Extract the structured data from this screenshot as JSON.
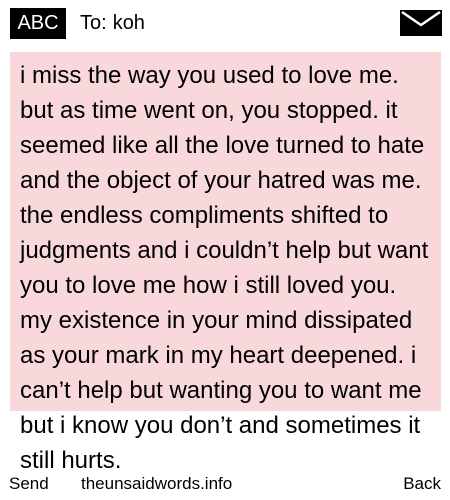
{
  "header": {
    "input_mode": "ABC",
    "to_label": "To:",
    "recipient": "koh",
    "icon": "envelope-icon"
  },
  "message": {
    "body": "i miss the way you used to love me. but as time went on, you stopped. it seemed like all the love turned to hate and the object of your hatred was me. the endless compliments shifted to judgments and i couldn’t help but want you to love me how i still loved you. my existence in your mind dissipated as your mark in my heart deepened. i can’t help but wanting you to want me but i know you don’t and sometimes it still hurts."
  },
  "softkeys": {
    "left": "Send",
    "center": "theunsaidwords.info",
    "right": "Back"
  },
  "colors": {
    "message_background": "#f9d8dc",
    "badge_background": "#000000"
  }
}
